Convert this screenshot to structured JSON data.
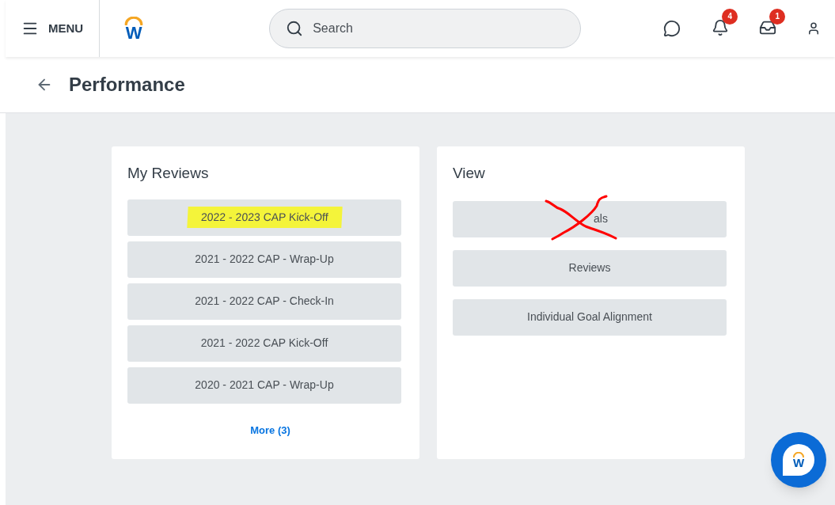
{
  "header": {
    "menu_label": "MENU",
    "logo_letter": "W",
    "search": {
      "placeholder": "Search"
    },
    "notifications_badge": "4",
    "inbox_badge": "1"
  },
  "page_title": "Performance",
  "my_reviews": {
    "title": "My Reviews",
    "items": [
      {
        "label": "2022 - 2023 CAP Kick-Off",
        "highlighted": true
      },
      {
        "label": "2021 - 2022 CAP - Wrap-Up",
        "highlighted": false
      },
      {
        "label": "2021 - 2022 CAP - Check-In",
        "highlighted": false
      },
      {
        "label": "2021 - 2022 CAP Kick-Off",
        "highlighted": false
      },
      {
        "label": "2020 - 2021 CAP - Wrap-Up",
        "highlighted": false
      }
    ],
    "more_link": "More (3)"
  },
  "view": {
    "title": "View",
    "items": [
      {
        "label": "als",
        "crossed_out": true
      },
      {
        "label": "Reviews",
        "crossed_out": false
      },
      {
        "label": "Individual Goal Alignment",
        "crossed_out": false
      }
    ]
  },
  "assistant_button": {
    "logo_letter": "W"
  }
}
